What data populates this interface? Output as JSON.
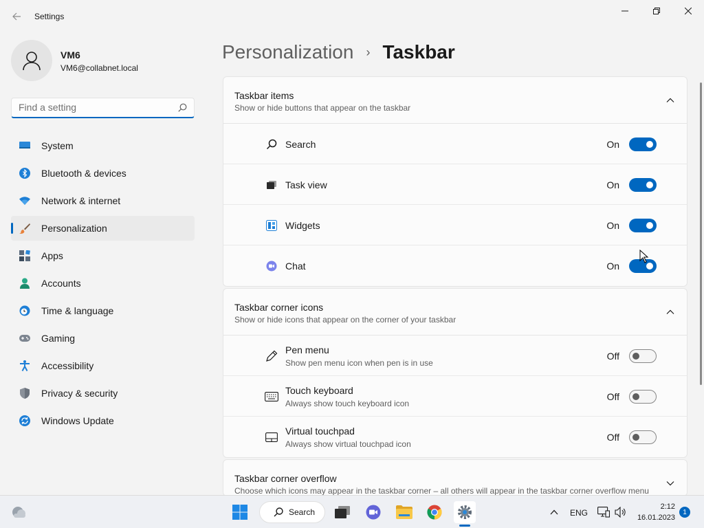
{
  "window": {
    "title": "Settings"
  },
  "profile": {
    "name": "VM6",
    "email": "VM6@collabnet.local"
  },
  "search": {
    "placeholder": "Find a setting"
  },
  "nav": [
    {
      "label": "System",
      "icon": "system-icon"
    },
    {
      "label": "Bluetooth & devices",
      "icon": "bluetooth-icon"
    },
    {
      "label": "Network & internet",
      "icon": "wifi-icon"
    },
    {
      "label": "Personalization",
      "icon": "brush-icon",
      "active": true
    },
    {
      "label": "Apps",
      "icon": "apps-icon"
    },
    {
      "label": "Accounts",
      "icon": "accounts-icon"
    },
    {
      "label": "Time & language",
      "icon": "clock-globe-icon"
    },
    {
      "label": "Gaming",
      "icon": "gamepad-icon"
    },
    {
      "label": "Accessibility",
      "icon": "accessibility-icon"
    },
    {
      "label": "Privacy & security",
      "icon": "shield-icon"
    },
    {
      "label": "Windows Update",
      "icon": "update-icon"
    }
  ],
  "breadcrumb": {
    "parent": "Personalization",
    "separator": "›",
    "current": "Taskbar"
  },
  "sections": {
    "items": {
      "title": "Taskbar items",
      "subtitle": "Show or hide buttons that appear on the taskbar",
      "rows": [
        {
          "label": "Search",
          "state": "On",
          "on": true,
          "icon": "search-icon"
        },
        {
          "label": "Task view",
          "state": "On",
          "on": true,
          "icon": "task-view-icon"
        },
        {
          "label": "Widgets",
          "state": "On",
          "on": true,
          "icon": "widgets-icon"
        },
        {
          "label": "Chat",
          "state": "On",
          "on": true,
          "icon": "chat-icon"
        }
      ]
    },
    "corner": {
      "title": "Taskbar corner icons",
      "subtitle": "Show or hide icons that appear on the corner of your taskbar",
      "rows": [
        {
          "label": "Pen menu",
          "desc": "Show pen menu icon when pen is in use",
          "state": "Off",
          "on": false,
          "icon": "pen-icon"
        },
        {
          "label": "Touch keyboard",
          "desc": "Always show touch keyboard icon",
          "state": "Off",
          "on": false,
          "icon": "keyboard-icon"
        },
        {
          "label": "Virtual touchpad",
          "desc": "Always show virtual touchpad icon",
          "state": "Off",
          "on": false,
          "icon": "touchpad-icon"
        }
      ]
    },
    "overflow": {
      "title": "Taskbar corner overflow",
      "subtitle": "Choose which icons may appear in the taskbar corner – all others will appear in the taskbar corner overflow menu"
    }
  },
  "taskbar": {
    "search_label": "Search",
    "language": "ENG",
    "time": "2:12",
    "date": "16.01.2023",
    "notification_count": "1"
  },
  "colors": {
    "accent": "#0067c0",
    "background": "#f3f3f3"
  }
}
